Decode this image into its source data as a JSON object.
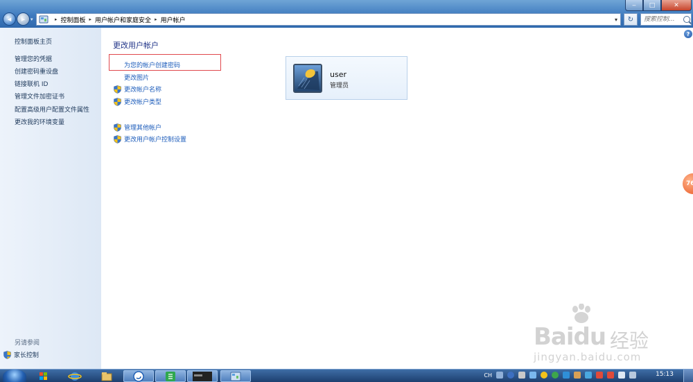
{
  "breadcrumb": [
    "控制面板",
    "用户帐户和家庭安全",
    "用户帐户"
  ],
  "search": {
    "placeholder": "搜索控制..."
  },
  "window_buttons": {
    "minimize": "‒",
    "maximize": "□",
    "close": "✕"
  },
  "sidebar": {
    "home": "控制面板主页",
    "items": [
      "管理您的凭据",
      "创建密码重设盘",
      "链接联机 ID",
      "管理文件加密证书",
      "配置高级用户配置文件属性",
      "更改我的环境变量"
    ],
    "see_also": "另请参阅",
    "parental_control": "家长控制"
  },
  "main": {
    "title": "更改用户帐户",
    "tasks": [
      {
        "label": "为您的帐户创建密码",
        "icon": "none"
      },
      {
        "label": "更改图片",
        "icon": "none"
      },
      {
        "label": "更改帐户名称",
        "icon": "uac-shield-icon"
      },
      {
        "label": "更改帐户类型",
        "icon": "uac-shield-icon"
      },
      {
        "label": "管理其他帐户",
        "icon": "uac-shield-icon"
      },
      {
        "label": "更改用户帐户控制设置",
        "icon": "uac-shield-icon"
      }
    ],
    "user": {
      "name": "user",
      "role": "管理员"
    }
  },
  "floating_badge": "76",
  "watermark": {
    "brand": "Baidu",
    "product": "经验",
    "url": "jingyan.baidu.com"
  },
  "taskbar": {
    "lang": "CH",
    "clock": "15:13"
  },
  "colors": {
    "highlight_box": "#e0474c",
    "link": "#1e5dbb",
    "title": "#1e3287"
  }
}
